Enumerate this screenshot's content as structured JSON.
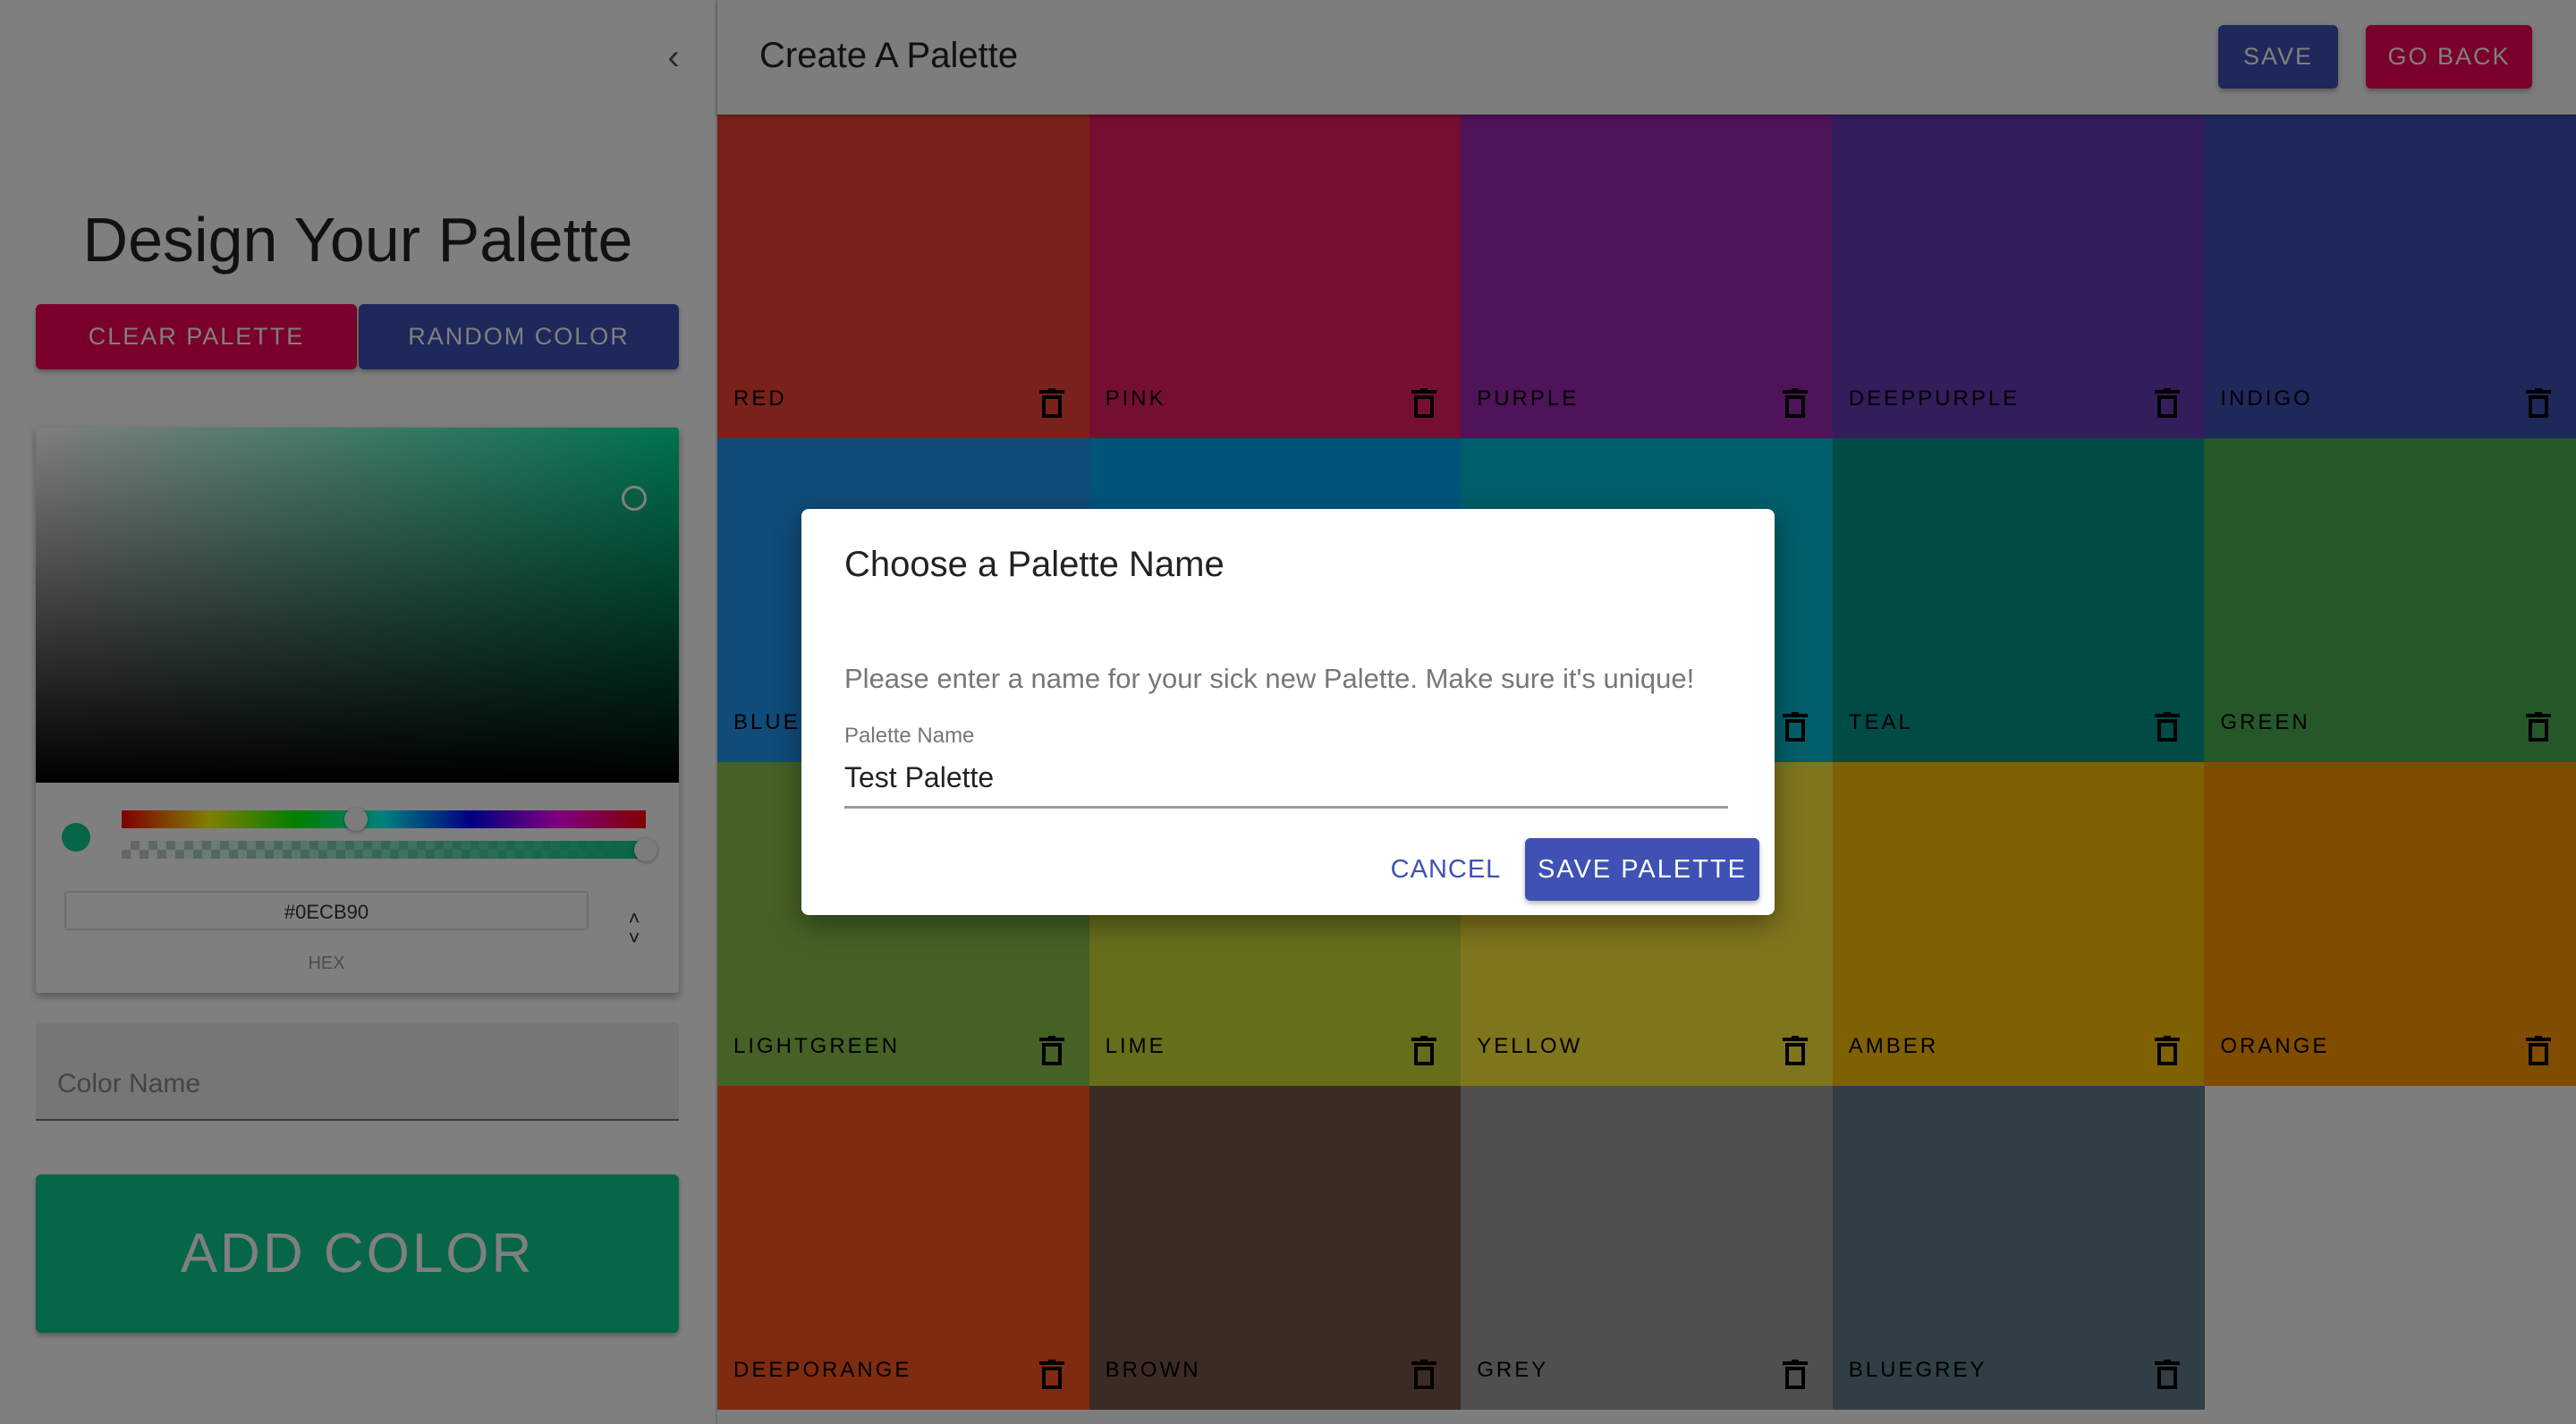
{
  "sidebar": {
    "collapse_icon": "chevron-left-icon",
    "title": "Design Your Palette",
    "clear_label": "CLEAR PALETTE",
    "random_label": "RANDOM COLOR",
    "clear_color": "#f50057",
    "random_color": "#3f51b5",
    "picker": {
      "hex": "#0ECB90",
      "hex_label": "HEX",
      "hue_degrees": 161,
      "saturation_percent": 93,
      "value_percent": 80,
      "alpha": 1
    },
    "color_name_placeholder": "Color Name",
    "add_label": "ADD COLOR",
    "add_color": "#0ECB90"
  },
  "header": {
    "title": "Create A Palette",
    "save_label": "SAVE",
    "go_back_label": "GO BACK",
    "save_color": "#3f51b5",
    "go_back_color": "#f50057"
  },
  "colors": [
    {
      "name": "red",
      "color": "#f44336"
    },
    {
      "name": "pink",
      "color": "#e91e63"
    },
    {
      "name": "purple",
      "color": "#9c27b0"
    },
    {
      "name": "deeppurple",
      "color": "#673ab7"
    },
    {
      "name": "indigo",
      "color": "#3f51b5"
    },
    {
      "name": "blue",
      "color": "#2196f3"
    },
    {
      "name": "",
      "color": "#03a9f4"
    },
    {
      "name": "",
      "color": "#00bcd4"
    },
    {
      "name": "teal",
      "color": "#009688"
    },
    {
      "name": "green",
      "color": "#4caf50"
    },
    {
      "name": "lightgreen",
      "color": "#8bc34a"
    },
    {
      "name": "lime",
      "color": "#cddc39"
    },
    {
      "name": "yellow",
      "color": "#ffeb3b"
    },
    {
      "name": "amber",
      "color": "#ffc107"
    },
    {
      "name": "orange",
      "color": "#ff9800"
    },
    {
      "name": "deeporange",
      "color": "#ff5722"
    },
    {
      "name": "brown",
      "color": "#795548"
    },
    {
      "name": "grey",
      "color": "#9e9e9e"
    },
    {
      "name": "bluegrey",
      "color": "#607d8b"
    }
  ],
  "dialog": {
    "title": "Choose a Palette Name",
    "text": "Please enter a name for your sick new Palette. Make sure it's unique!",
    "field_label": "Palette Name",
    "field_value": "Test Palette",
    "cancel_label": "CANCEL",
    "save_label": "SAVE PALETTE"
  }
}
